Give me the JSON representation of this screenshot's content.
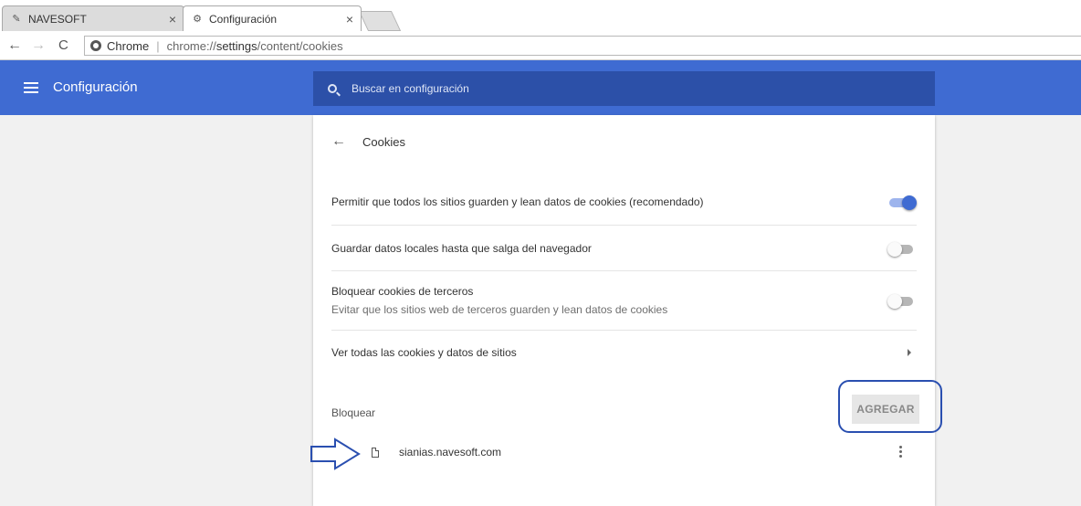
{
  "tabs": [
    {
      "title": "NAVESOFT",
      "active": false
    },
    {
      "title": "Configuración",
      "active": true
    }
  ],
  "omnibox": {
    "scheme_label": "Chrome",
    "url_prefix": "chrome://",
    "url_host": "settings",
    "url_path": "/content/cookies"
  },
  "header": {
    "title": "Configuración",
    "search_placeholder": "Buscar en configuración"
  },
  "page": {
    "title": "Cookies",
    "rows": [
      {
        "label": "Permitir que todos los sitios guarden y lean datos de cookies (recomendado)",
        "toggle_on": true
      },
      {
        "label": "Guardar datos locales hasta que salga del navegador",
        "toggle_on": false
      },
      {
        "label": "Bloquear cookies de terceros",
        "sublabel": "Evitar que los sitios web de terceros guarden y lean datos de cookies",
        "toggle_on": false
      },
      {
        "label": "Ver todas las cookies y datos de sitios"
      }
    ],
    "block_section": {
      "label": "Bloquear",
      "add_button": "AGREGAR",
      "sites": [
        "sianias.navesoft.com"
      ]
    }
  },
  "colors": {
    "accent": "#3f6bd2",
    "header_bg": "#3f6bd2",
    "search_bg": "#2c50a8",
    "annotation": "#2a4fb0"
  }
}
